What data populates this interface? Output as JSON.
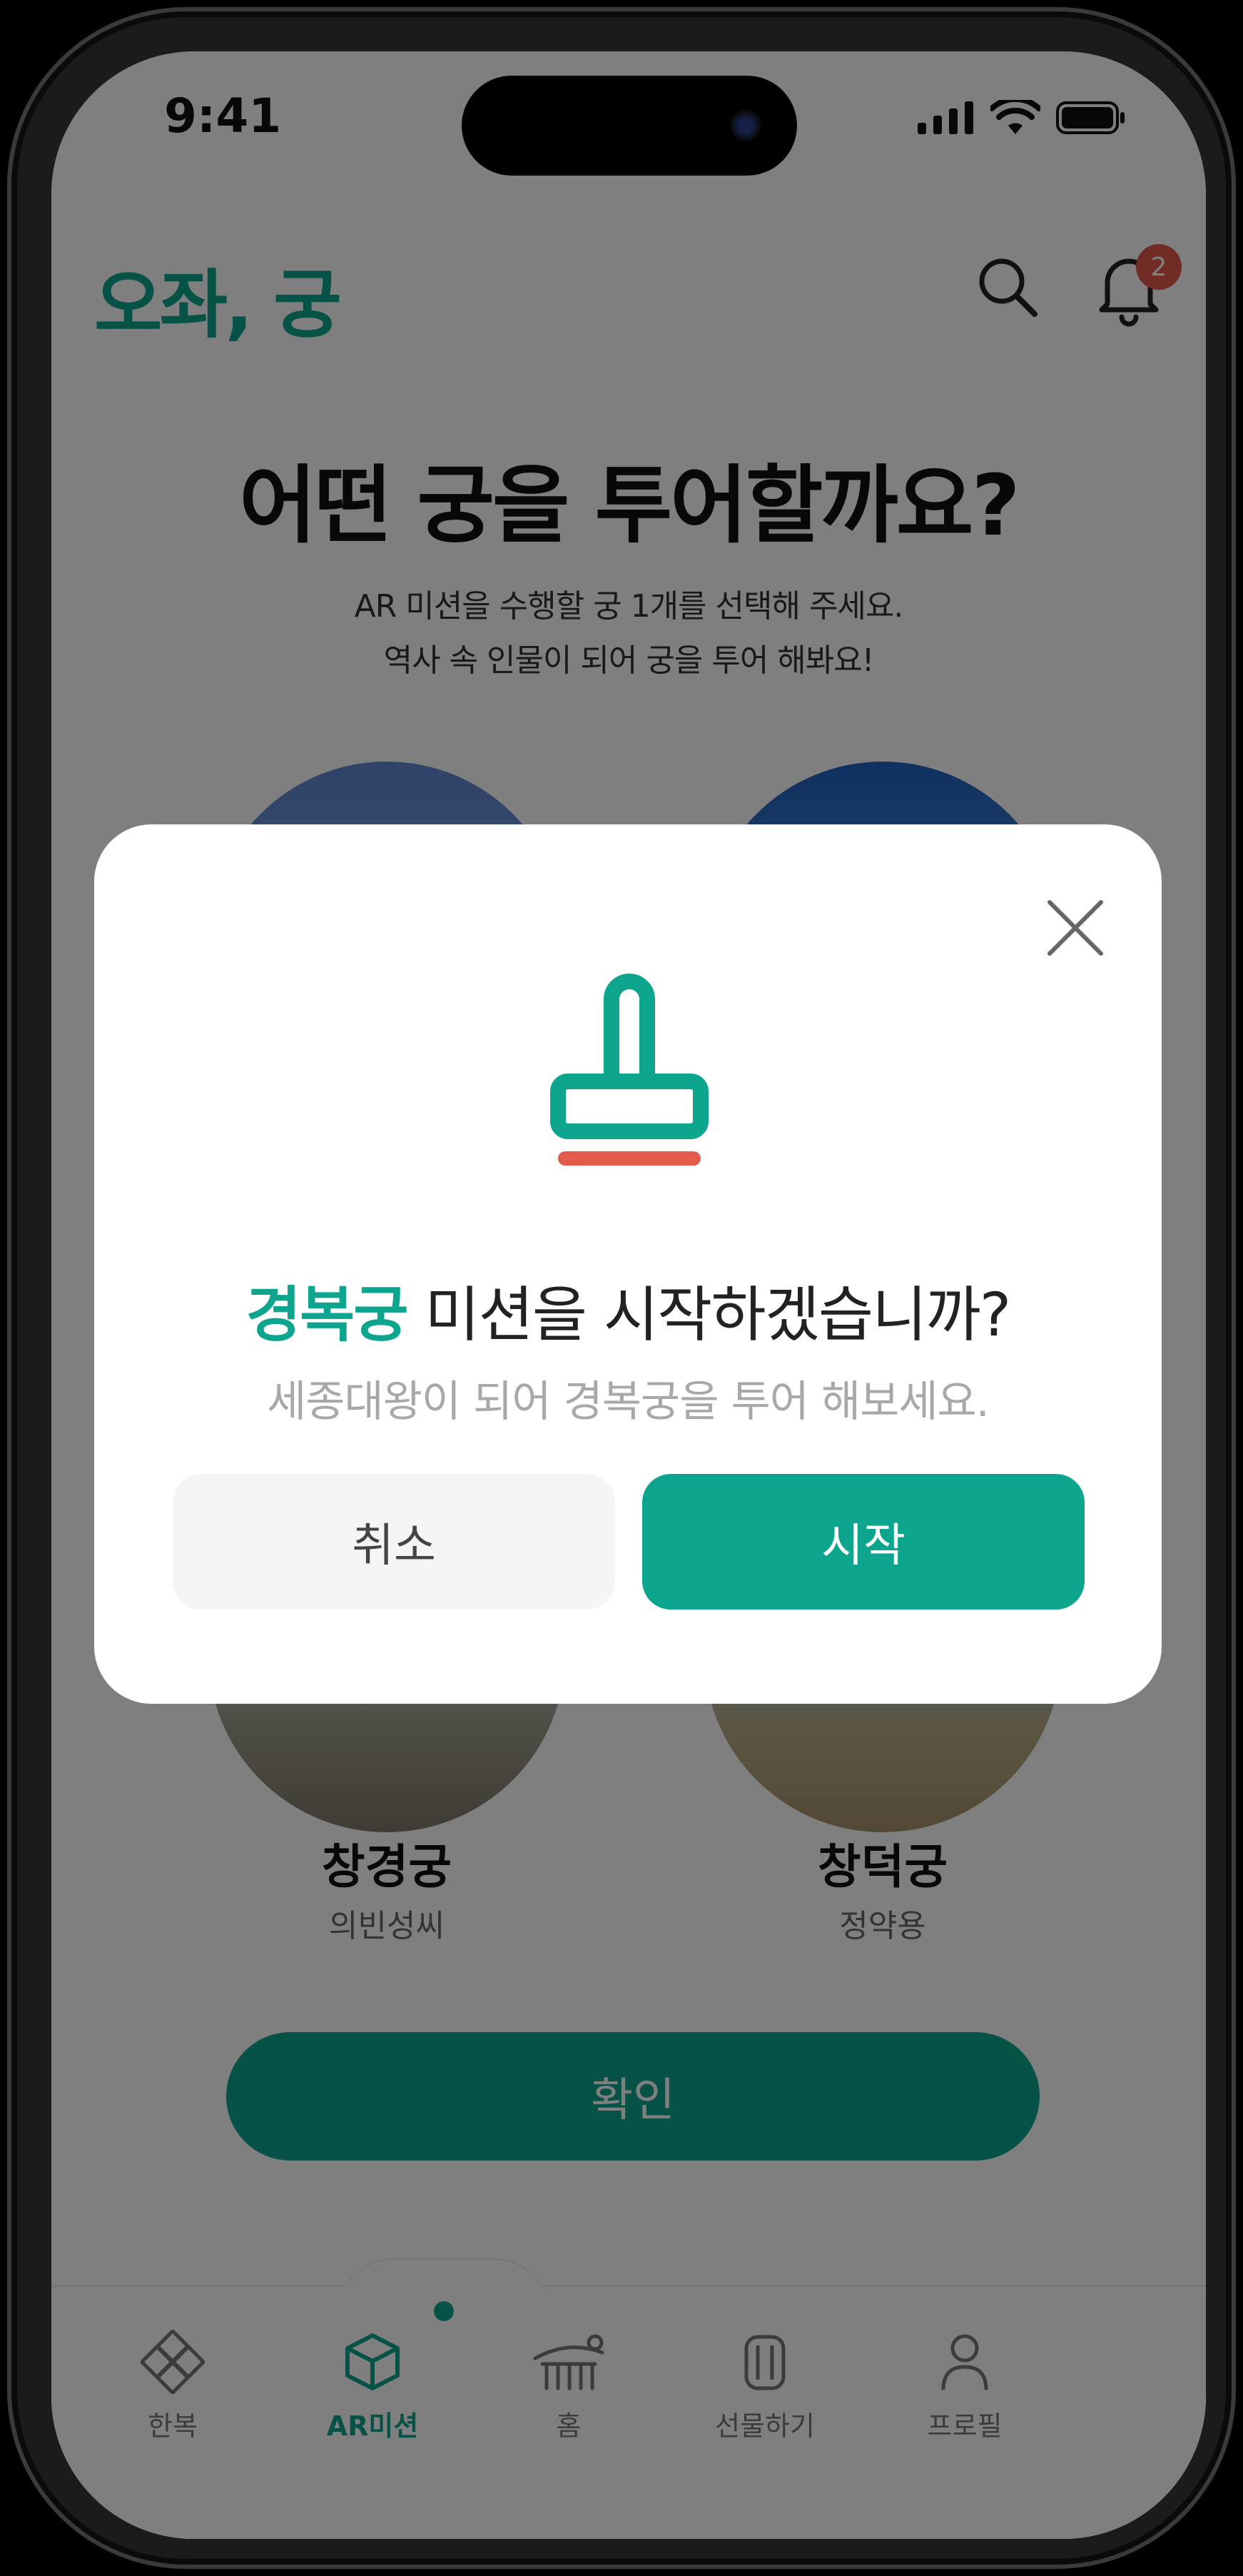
{
  "status_bar": {
    "time": "9:41"
  },
  "header": {
    "logo": "오좌, 궁",
    "notification_count": "2",
    "accent_color": "#0ea58f",
    "icons": [
      "search-icon",
      "bell-icon"
    ]
  },
  "main": {
    "headline": "어떤 궁을 투어할까요?",
    "subtext_line1": "AR 미션을 수행할 궁 1개를 선택해 주세요.",
    "subtext_line2": "역사 속 인물이 되어 궁을 투어 해봐요!",
    "palaces": [
      {
        "name": "창경궁",
        "person": "의빈성씨"
      },
      {
        "name": "창덕궁",
        "person": "정약용"
      }
    ],
    "confirm_label": "확인"
  },
  "tab_bar": {
    "items": [
      {
        "label": "한복",
        "icon": "knot-icon"
      },
      {
        "label": "AR미션",
        "icon": "ar-cube-icon"
      },
      {
        "label": "홈",
        "icon": "home-roof-icon"
      },
      {
        "label": "선물하기",
        "icon": "gift-icon"
      },
      {
        "label": "프로필",
        "icon": "person-icon"
      }
    ],
    "active": "AR미션"
  },
  "modal": {
    "title_accent": "경복궁",
    "title_rest": " 미션을 시작하겠습니까?",
    "subtitle": "세종대왕이 되어 경복궁을 투어 해보세요.",
    "cancel_label": "취소",
    "start_label": "시작",
    "stamp_colors": {
      "body": "#0ea58f",
      "ink": "#e35b4a"
    }
  }
}
